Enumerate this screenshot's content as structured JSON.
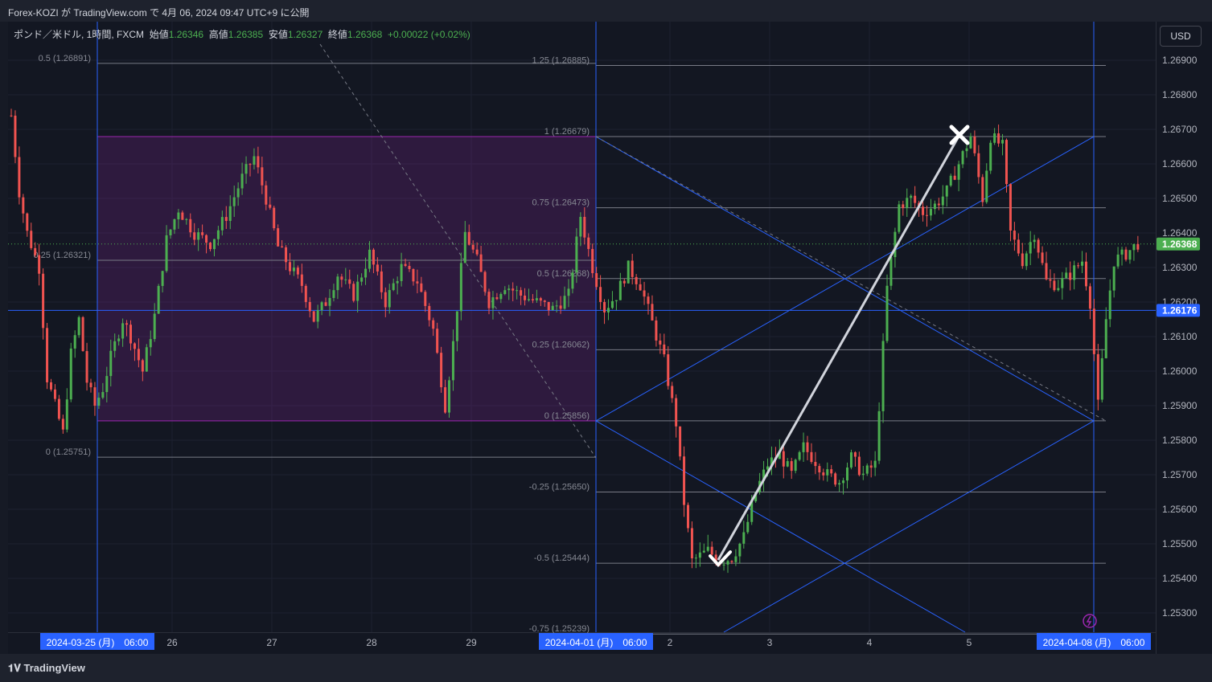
{
  "header": {
    "title": "Forex-KOZI が TradingView.com で 4月 06, 2024 09:47 UTC+9 に公開"
  },
  "legend": {
    "symbol": "ポンド／米ドル, 1時間, FXCM",
    "open_label": "始値",
    "open": "1.26346",
    "high_label": "高値",
    "high": "1.26385",
    "low_label": "安値",
    "low": "1.26327",
    "close_label": "終値",
    "close": "1.26368",
    "change": "+0.00022 (+0.02%)"
  },
  "currency_button": "USD",
  "footer": {
    "brand": "TradingView"
  },
  "colors": {
    "up": "#4caf50",
    "down": "#f05350",
    "trendline": "#2962ff",
    "box": "#9c27b0",
    "background": "#131722"
  },
  "chart_data": {
    "type": "candlestick",
    "price_axis": {
      "range": [
        1.2525,
        1.2693
      ],
      "ticks": [
        "1.25300",
        "1.25400",
        "1.25500",
        "1.25600",
        "1.25700",
        "1.25800",
        "1.25900",
        "1.26000",
        "1.26100",
        "1.26200",
        "1.26300",
        "1.26400",
        "1.26500",
        "1.26600",
        "1.26700",
        "1.26800",
        "1.26900"
      ]
    },
    "price_labels": {
      "last": "1.26368",
      "crosshair": "1.26176"
    },
    "time_axis": {
      "ticks": [
        "26",
        "27",
        "28",
        "29",
        "2",
        "3",
        "4",
        "5"
      ],
      "highlighted": [
        "2024-03-25 (月)　06:00",
        "2024-04-01 (月)　06:00",
        "2024-04-08 (月)　06:00"
      ]
    },
    "fib_left": [
      {
        "label": "0.5 (1.26891)",
        "price": 1.26891
      },
      {
        "label": "0.25 (1.26321)",
        "price": 1.26321
      },
      {
        "label": "0 (1.25751)",
        "price": 1.25751
      }
    ],
    "fib_right": [
      {
        "label": "1.25 (1.26885)",
        "price": 1.26885
      },
      {
        "label": "1 (1.26679)",
        "price": 1.26679
      },
      {
        "label": "0.75 (1.26473)",
        "price": 1.26473
      },
      {
        "label": "0.5 (1.26268)",
        "price": 1.26268
      },
      {
        "label": "0.25 (1.26062)",
        "price": 1.26062
      },
      {
        "label": "0 (1.25856)",
        "price": 1.25856
      },
      {
        "label": "-0.25 (1.25650)",
        "price": 1.2565
      },
      {
        "label": "-0.5 (1.25444)",
        "price": 1.25444
      },
      {
        "label": "-0.75 (1.25239)",
        "price": 1.25239
      }
    ],
    "range_box": {
      "from_label": "2024-03-25 (月)　06:00",
      "to_label": "2024-04-01 (月)　06:00",
      "high": 1.26679,
      "low": 1.25856
    },
    "projection_arrow": {
      "from_price": 1.25444,
      "to_price": 1.26679
    },
    "price_path": [
      [
        0,
        1.2674
      ],
      [
        2,
        1.2652
      ],
      [
        4,
        1.264
      ],
      [
        7,
        1.263
      ],
      [
        9,
        1.2598
      ],
      [
        11,
        1.259
      ],
      [
        13,
        1.2582
      ],
      [
        15,
        1.2605
      ],
      [
        17,
        1.2615
      ],
      [
        19,
        1.2597
      ],
      [
        21,
        1.259
      ],
      [
        23,
        1.2595
      ],
      [
        25,
        1.2604
      ],
      [
        28,
        1.2615
      ],
      [
        30,
        1.261
      ],
      [
        33,
        1.26
      ],
      [
        36,
        1.2616
      ],
      [
        39,
        1.2638
      ],
      [
        42,
        1.2647
      ],
      [
        46,
        1.264
      ],
      [
        50,
        1.2637
      ],
      [
        54,
        1.2645
      ],
      [
        58,
        1.2656
      ],
      [
        61,
        1.2662
      ],
      [
        64,
        1.265
      ],
      [
        67,
        1.2636
      ],
      [
        70,
        1.263
      ],
      [
        73,
        1.2625
      ],
      [
        76,
        1.2615
      ],
      [
        79,
        1.262
      ],
      [
        82,
        1.2628
      ],
      [
        86,
        1.2622
      ],
      [
        90,
        1.2634
      ],
      [
        94,
        1.262
      ],
      [
        98,
        1.263
      ],
      [
        102,
        1.2626
      ],
      [
        106,
        1.2612
      ],
      [
        109,
        1.259
      ],
      [
        111,
        1.2608
      ],
      [
        114,
        1.264
      ],
      [
        117,
        1.2632
      ],
      [
        120,
        1.262
      ],
      [
        124,
        1.2625
      ],
      [
        128,
        1.2622
      ],
      [
        132,
        1.262
      ],
      [
        136,
        1.2618
      ],
      [
        140,
        1.2622
      ],
      [
        143,
        1.2645
      ],
      [
        146,
        1.263
      ],
      [
        149,
        1.2618
      ],
      [
        152,
        1.2622
      ],
      [
        155,
        1.263
      ],
      [
        158,
        1.2625
      ],
      [
        161,
        1.2614
      ],
      [
        164,
        1.2603
      ],
      [
        167,
        1.2585
      ],
      [
        169,
        1.2562
      ],
      [
        171,
        1.2545
      ],
      [
        175,
        1.2548
      ],
      [
        178,
        1.2545
      ],
      [
        181,
        1.2546
      ],
      [
        184,
        1.2552
      ],
      [
        187,
        1.2565
      ],
      [
        190,
        1.2573
      ],
      [
        193,
        1.2576
      ],
      [
        196,
        1.257
      ],
      [
        199,
        1.2578
      ],
      [
        202,
        1.2574
      ],
      [
        205,
        1.257
      ],
      [
        208,
        1.2568
      ],
      [
        211,
        1.2575
      ],
      [
        214,
        1.257
      ],
      [
        217,
        1.2573
      ],
      [
        220,
        1.2624
      ],
      [
        223,
        1.2648
      ],
      [
        226,
        1.265
      ],
      [
        229,
        1.2646
      ],
      [
        232,
        1.2648
      ],
      [
        235,
        1.2652
      ],
      [
        238,
        1.266
      ],
      [
        241,
        1.2668
      ],
      [
        244,
        1.265
      ],
      [
        246,
        1.2668
      ],
      [
        249,
        1.2665
      ],
      [
        251,
        1.264
      ],
      [
        254,
        1.2632
      ],
      [
        257,
        1.264
      ],
      [
        260,
        1.2626
      ],
      [
        263,
        1.2625
      ],
      [
        266,
        1.2628
      ],
      [
        269,
        1.2632
      ],
      [
        271,
        1.262
      ],
      [
        273,
        1.259
      ],
      [
        275,
        1.2615
      ],
      [
        277,
        1.2632
      ],
      [
        280,
        1.2634
      ],
      [
        283,
        1.2637
      ]
    ]
  }
}
